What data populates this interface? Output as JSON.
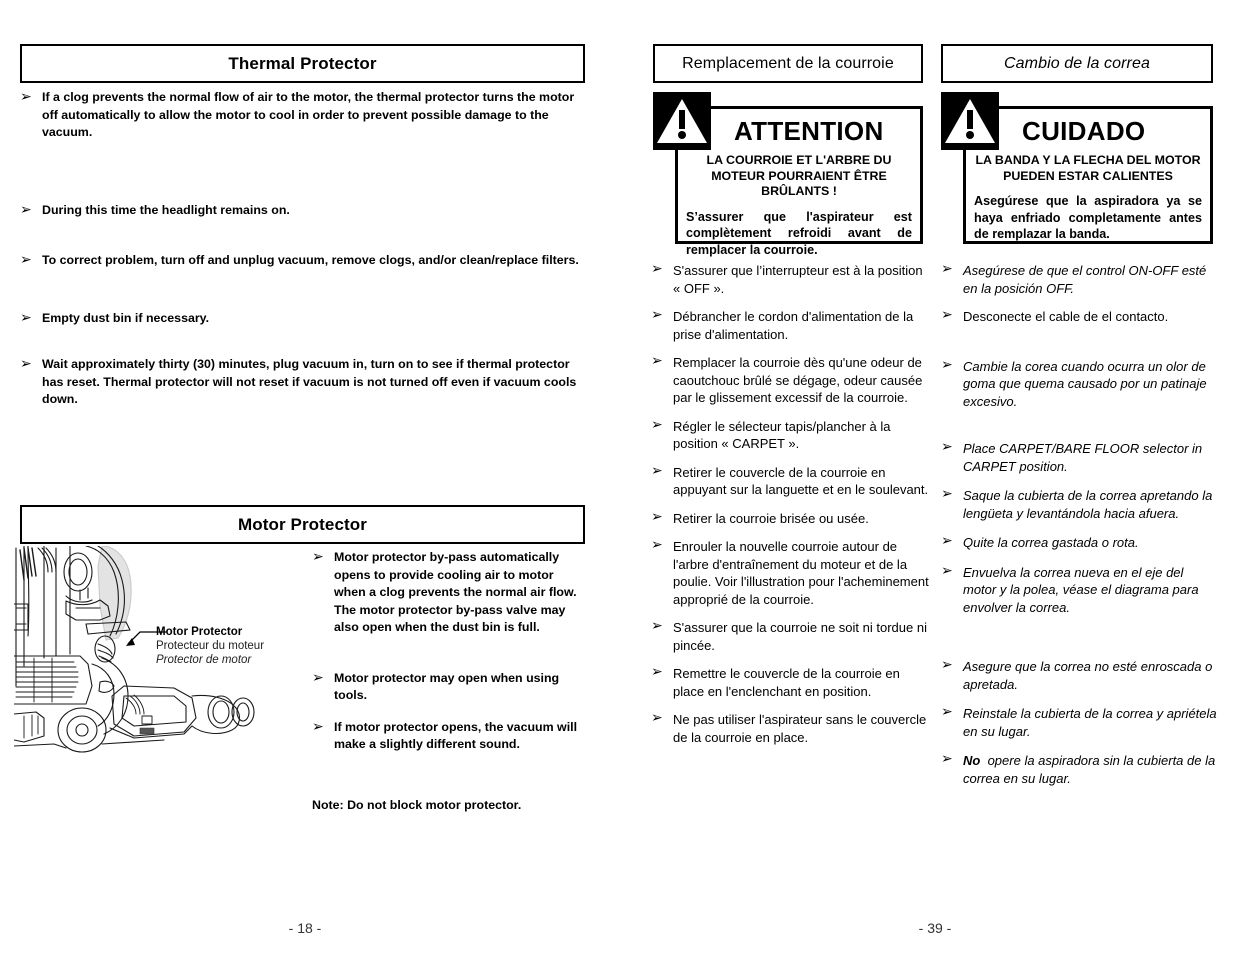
{
  "left_page": {
    "section1": {
      "title": "Thermal Protector",
      "bullets": [
        "If a clog prevents the normal flow of air to the motor, the thermal protector turns the motor off automatically to allow the motor to cool in order to prevent possible damage to the vacuum.",
        "During this time the headlight remains on.",
        "To correct problem, turn off and unplug vacuum, remove clogs, and/or clean/replace filters.",
        "Empty dust bin if necessary.",
        "Wait approximately thirty (30) minutes, plug vacuum in, turn on to see if thermal protector has reset. Thermal protector will not reset if vacuum is not turned off even if vacuum cools down."
      ]
    },
    "section2": {
      "title": "Motor Protector",
      "callout": {
        "en": "Motor Protector",
        "fr": "Protecteur du moteur",
        "es": "Protector de motor"
      },
      "bullets": [
        "Motor protector by-pass automatically opens to provide cooling air to motor when a clog prevents the normal air flow. The motor protector by-pass valve may also open when the dust bin is full.",
        "Motor protector may open when using tools.",
        "If motor protector opens, the vacuum will make a slightly different sound."
      ],
      "note": "Note: Do not block motor protector."
    },
    "page_number": "- 18 -"
  },
  "middle_page": {
    "title": "Remplacement de la courroie",
    "warning": {
      "word": "ATTENTION",
      "caps": "LA COURROIE ET L'ARBRE DU MOTEUR POURRAIENT ÊTRE BRÛLANTS !",
      "body": "S’assurer que l'aspirateur est complètement refroidi avant de remplacer la courroie."
    },
    "bullets": [
      "S'assurer que l’interrupteur est à la position « OFF ».",
      "Débrancher le cordon d'alimentation de la prise d'alimentation.",
      "Remplacer la courroie dès qu'une odeur de caoutchouc brûlé se dégage, odeur causée par le glissement excessif de la courroie.",
      "Régler le sélecteur tapis/plancher à la position « CARPET ».",
      "Retirer le couvercle de la courroie en appuyant sur la languette et en le soulevant.",
      "Retirer la courroie brisée ou usée.",
      "Enrouler la nouvelle courroie autour de l'arbre d'entraînement du moteur et de la poulie. Voir l'illustration pour l'acheminement approprié de la courroie.",
      "S'assurer que la courroie ne soit ni tordue ni pincée.",
      "Remettre le couvercle de la courroie en place en l'enclenchant en position.",
      "Ne pas utiliser l'aspirateur sans le couvercle de la courroie en place."
    ]
  },
  "right_page": {
    "title": "Cambio de la correa",
    "warning": {
      "word": "CUIDADO",
      "caps": "LA BANDA Y LA FLECHA DEL MOTOR PUEDEN ESTAR CALIENTES",
      "body": "Asegúrese que la aspiradora ya se haya enfriado completamente antes de remplazar la banda."
    },
    "bullets": [
      "Asegúrese de que el control ON-OFF esté en la posición OFF.",
      "Desconecte el cable de el contacto.",
      "Cambie la corea cuando ocurra un olor de goma que quema causado por un patinaje excesivo.",
      "Place CARPET/BARE FLOOR selector in CARPET position.",
      "Saque la cubierta de la correa apretando la lengüeta y levantándola hacia afuera.",
      "Quite la correa gastada o rota.",
      "Envuelva la correa nueva en el eje del motor y la polea, véase el diagrama para envolver la correa.",
      "Asegure que la correa no esté enroscada o apretada.",
      "Reinstale la cubierta de la correa y apriétela en su lugar.",
      "opere la aspiradora sin la cubierta de la correa en su lugar."
    ],
    "bullet_last_bold_prefix": "No",
    "page_number": "- 39 -"
  },
  "icons": {
    "bullet_arrow": "➢",
    "warning_triangle": "warning-triangle-icon"
  },
  "colors": {
    "ink": "#000000",
    "paper": "#ffffff",
    "illustration_shade": "#e3e3e3"
  }
}
